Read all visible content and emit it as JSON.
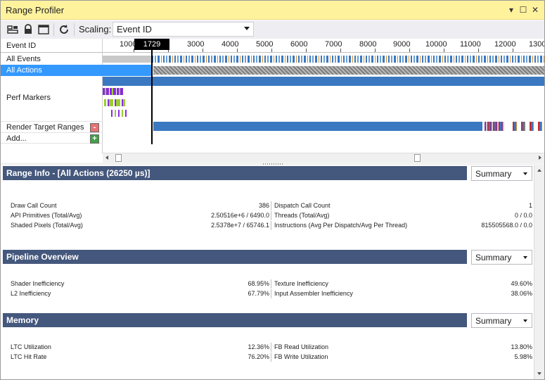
{
  "window": {
    "title": "Range Profiler",
    "buttons": {
      "dropdown": "▾",
      "maximize": "☐",
      "close": "✕"
    }
  },
  "toolbar": {
    "icons": [
      "layout-icon",
      "lock-icon",
      "window-icon",
      "refresh-icon"
    ],
    "scaling_label": "Scaling:",
    "scaling_value": "Event ID"
  },
  "timeline": {
    "axis_label": "Event ID",
    "ticks": [
      "1000",
      "3000",
      "4000",
      "5000",
      "6000",
      "7000",
      "8000",
      "9000",
      "10000",
      "11000",
      "12000",
      "1300"
    ],
    "current_marker": "1729",
    "rows": [
      {
        "label": "All Events"
      },
      {
        "label": "All Actions",
        "selected": true
      },
      {
        "label": "Perf Markers"
      },
      {
        "label": "Render Target Ranges"
      },
      {
        "label": "Add..."
      }
    ],
    "remove_button": "-",
    "add_button": "+",
    "colors": {
      "selection": "#3399ff",
      "bar": "#3a78c2",
      "marker_purple": "#8a2be2",
      "marker_green": "#9acd32",
      "red": "#d32f2f"
    }
  },
  "range_info": {
    "title": "Range Info - [All Actions (26250 µs)]",
    "mode": "Summary",
    "rows": [
      {
        "l1": "Draw Call Count",
        "v1": "386",
        "l2": "Dispatch Call Count",
        "v2": "1"
      },
      {
        "l1": "API Primitives (Total/Avg)",
        "v1": "2.50516e+6 / 6490.0",
        "l2": "Threads (Total/Avg)",
        "v2": "0 / 0.0"
      },
      {
        "l1": "Shaded Pixels (Total/Avg)",
        "v1": "2.5378e+7 / 65746.1",
        "l2": "Instructions (Avg Per Dispatch/Avg Per Thread)",
        "v2": "815505568.0 / 0.0"
      }
    ]
  },
  "pipeline": {
    "title": "Pipeline Overview",
    "mode": "Summary",
    "rows": [
      {
        "l1": "Shader Inefficiency",
        "v1": "68.95%",
        "l2": "Texture Inefficiency",
        "v2": "49.60%"
      },
      {
        "l1": "L2 Inefficiency",
        "v1": "67.79%",
        "l2": "Input Assembler Inefficiency",
        "v2": "38.06%"
      }
    ]
  },
  "memory": {
    "title": "Memory",
    "mode": "Summary",
    "rows": [
      {
        "l1": "LTC Utilization",
        "v1": "12.36%",
        "l2": "FB Read Utilization",
        "v2": "13.80%"
      },
      {
        "l1": "LTC Hit Rate",
        "v1": "76.20%",
        "l2": "FB Write Utilization",
        "v2": "5.98%"
      }
    ]
  }
}
